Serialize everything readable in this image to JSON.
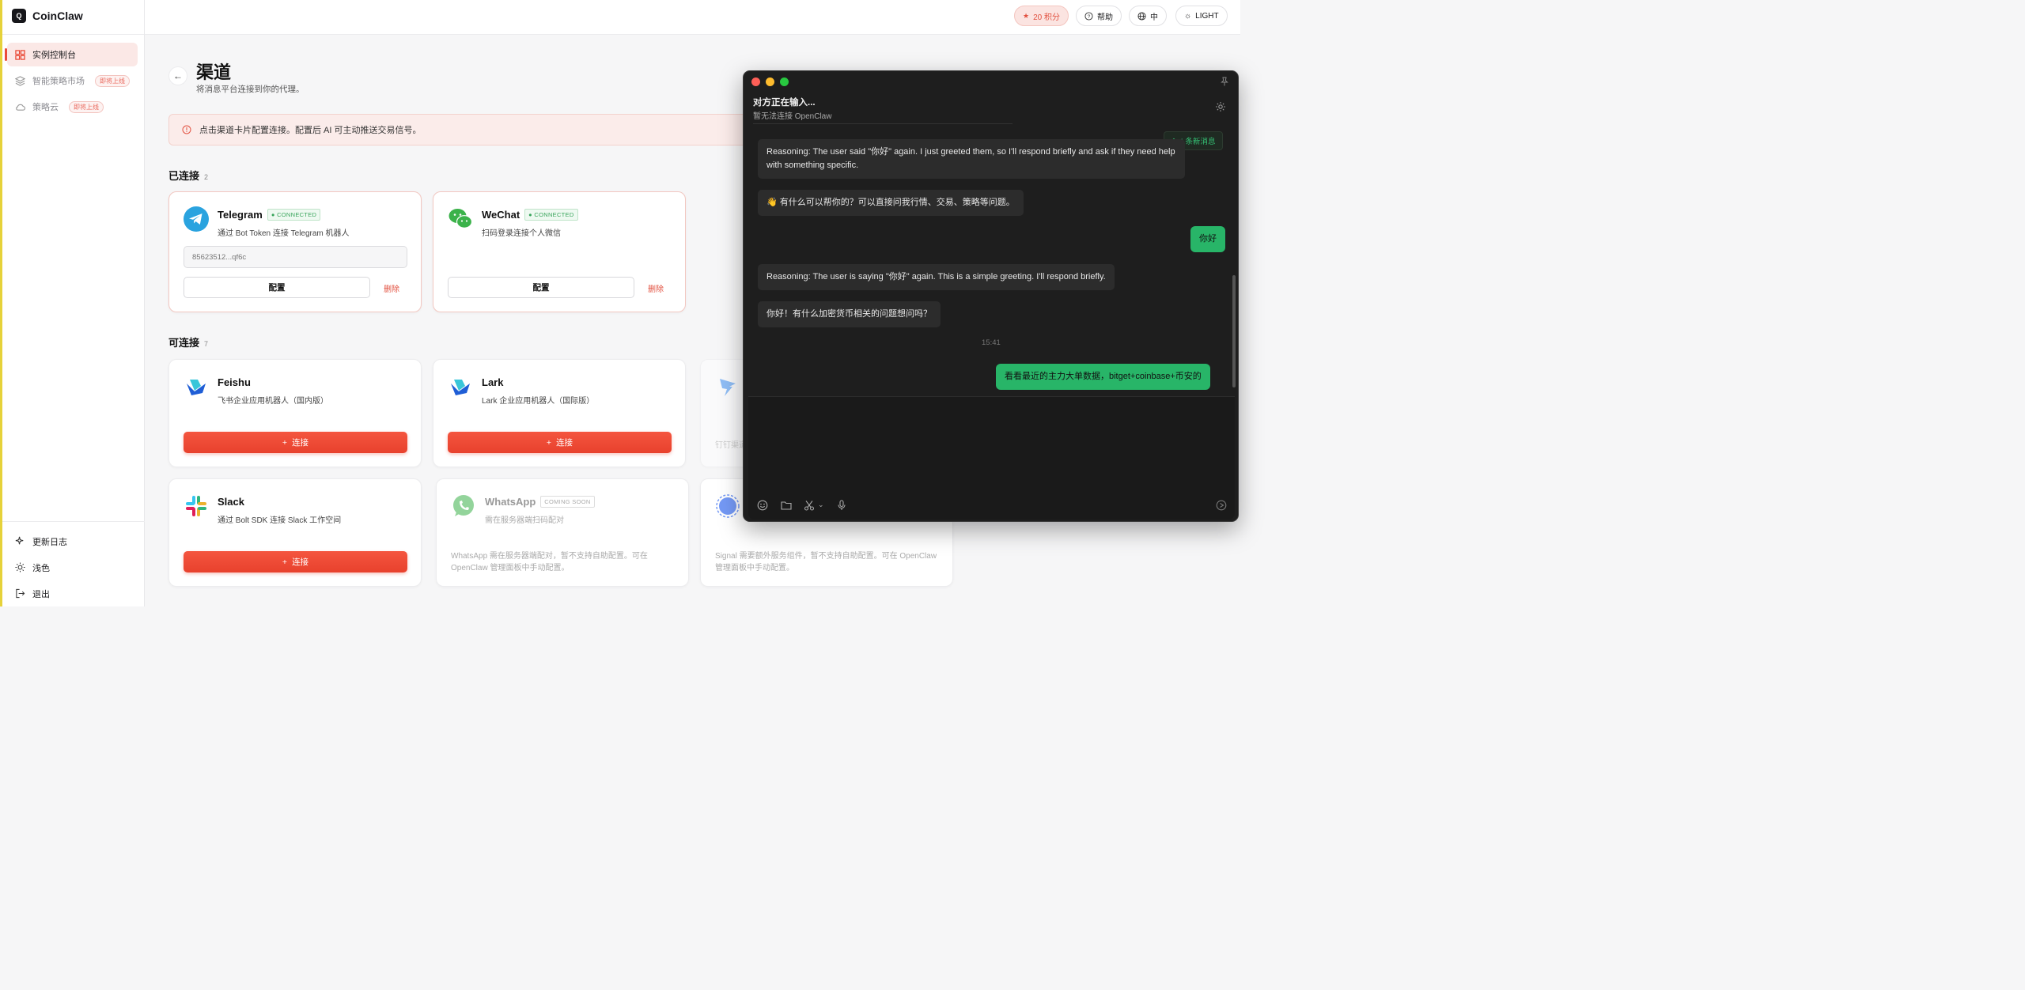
{
  "app": {
    "name": "CoinClaw"
  },
  "sidebar": {
    "items": [
      {
        "label": "实例控制台",
        "badge": ""
      },
      {
        "label": "智能策略市场",
        "badge": "即将上线"
      },
      {
        "label": "策略云",
        "badge": "即将上线"
      }
    ],
    "bottom": [
      {
        "label": "更新日志"
      },
      {
        "label": "浅色"
      },
      {
        "label": "退出"
      }
    ]
  },
  "topbar": {
    "points": "20 积分",
    "help": "帮助",
    "lang": "中",
    "theme": "LIGHT"
  },
  "page": {
    "title": "渠道",
    "subtitle": "将消息平台连接到你的代理。",
    "notice": "点击渠道卡片配置连接。配置后 AI 可主动推送交易信号。"
  },
  "connected": {
    "title": "已连接",
    "count": "2",
    "cards": [
      {
        "name": "Telegram",
        "badge": "CONNECTED",
        "desc": "通过 Bot Token 连接 Telegram 机器人",
        "token": "85623512...qf6c",
        "config": "配置",
        "delete": "删除"
      },
      {
        "name": "WeChat",
        "badge": "CONNECTED",
        "desc": "扫码登录连接个人微信",
        "config": "配置",
        "delete": "删除"
      }
    ]
  },
  "available": {
    "title": "可连接",
    "count": "7",
    "cards": [
      {
        "name": "Feishu",
        "desc": "飞书企业应用机器人（国内版）",
        "button": "连接"
      },
      {
        "name": "Lark",
        "desc": "Lark 企业应用机器人（国际版）",
        "button": "连接"
      },
      {
        "name": "",
        "desc": "钉钉渠道"
      },
      {
        "name": "Slack",
        "desc": "通过 Bolt SDK 连接 Slack 工作空间",
        "button": "连接"
      },
      {
        "name": "WhatsApp",
        "badge": "COMING SOON",
        "desc": "需在服务器端扫码配对",
        "note": "WhatsApp 需在服务器端配对，暂不支持自助配置。可在 OpenClaw 管理面板中手动配置。"
      },
      {
        "name": "",
        "note": "Signal 需要额外服务组件，暂不支持自助配置。可在 OpenClaw 管理面板中手动配置。"
      }
    ]
  },
  "chat": {
    "title": "对方正在输入...",
    "subtitle": "暂无法连接 OpenClaw",
    "new_messages": "4 条新消息",
    "messages": [
      {
        "from": "bot",
        "text": "Reasoning: The user said \"你好\" again. I just greeted them, so I'll respond briefly and ask if they need help with something specific."
      },
      {
        "from": "bot",
        "text": "👋 有什么可以帮你的？可以直接问我行情、交易、策略等问题。"
      },
      {
        "from": "me",
        "text": "你好"
      },
      {
        "from": "bot",
        "text": "Reasoning: The user is saying \"你好\" again. This is a simple greeting. I'll respond briefly."
      },
      {
        "from": "bot",
        "text": "你好！有什么加密货币相关的问题想问吗？"
      },
      {
        "from": "me",
        "text": "看看最近的主力大单数据，bitget+coinbase+币安的"
      }
    ],
    "timestamp": "15:41"
  },
  "colors": {
    "accent": "#e8412d",
    "chat_bg": "#1e1e1e",
    "me_bubble": "#28b568"
  }
}
